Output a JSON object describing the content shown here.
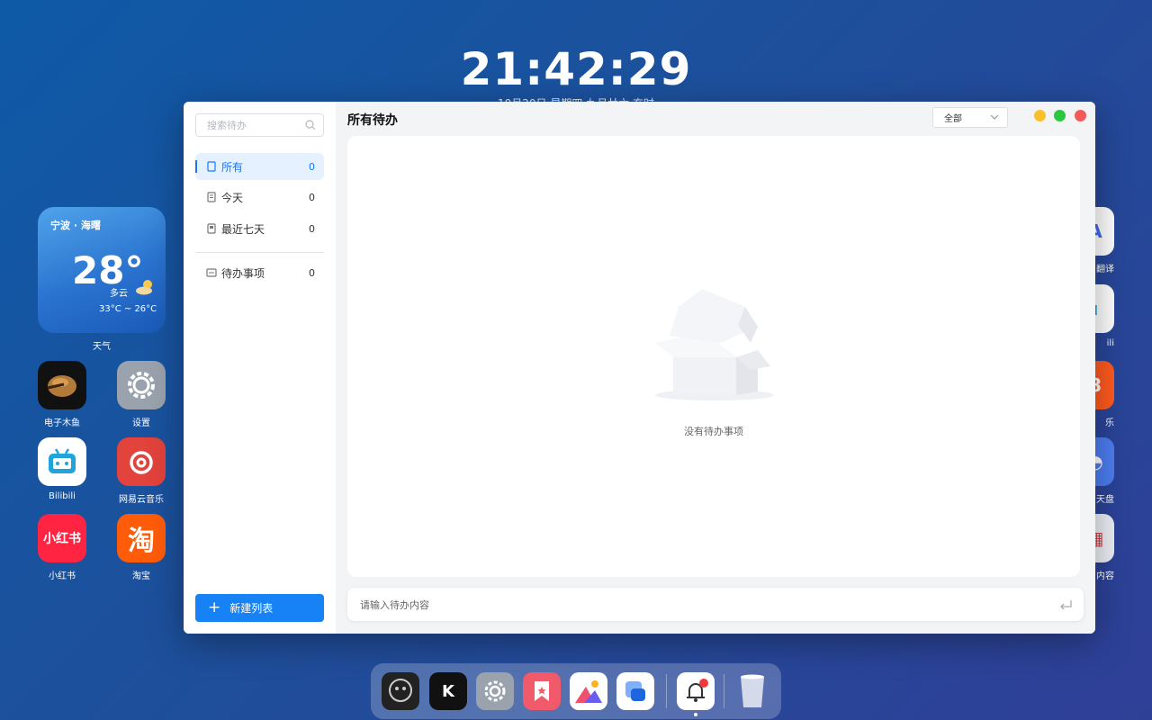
{
  "clock": {
    "time": "21:42:29",
    "date": "10月20日 星期四 九月廿六 亥时"
  },
  "weather": {
    "location": "宁波 · 海曙",
    "temp": "28°",
    "condition": "多云",
    "range": "33°C ~ 26°C",
    "label": "天气"
  },
  "desktop_apps": [
    {
      "label": "电子木鱼"
    },
    {
      "label": "设置"
    },
    {
      "label": "Bilibili"
    },
    {
      "label": "网易云音乐"
    },
    {
      "label": "小红书",
      "tile_text": "小红书"
    },
    {
      "label": "淘宝",
      "tile_text": "淘"
    }
  ],
  "right_apps": [
    {
      "label": "翻译"
    },
    {
      "label": "ili"
    },
    {
      "label": "乐"
    },
    {
      "label": "天盘"
    },
    {
      "label": "内容"
    }
  ],
  "todo": {
    "search_placeholder": "搜索待办",
    "nav": [
      {
        "label": "所有",
        "count": "0"
      },
      {
        "label": "今天",
        "count": "0"
      },
      {
        "label": "最近七天",
        "count": "0"
      },
      {
        "label": "待办事项",
        "count": "0"
      }
    ],
    "new_list": "新建列表",
    "title": "所有待办",
    "filter_value": "全部",
    "empty_text": "没有待办事项",
    "input_placeholder": "请输入待办内容"
  },
  "colors": {
    "accent": "#1677ff",
    "close": "#f2595b",
    "minimize": "#fbbf2c",
    "maximize": "#29c840"
  }
}
